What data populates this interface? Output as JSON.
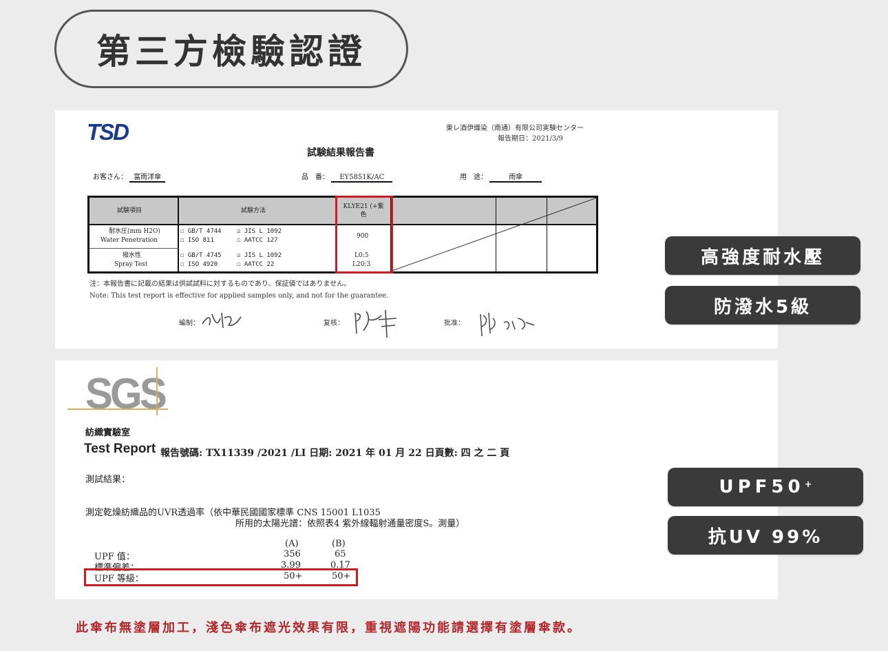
{
  "title": "第三方檢驗認證",
  "tsd_report": {
    "logo": "TSD",
    "lab_name": "東レ酒伊織染（南通）有限公司実験センター",
    "report_date": "報告期日：2021/3/9",
    "heading": "試験結果報告書",
    "customer_label": "お客さん：",
    "customer_value": "富雨洋傘",
    "product_no_label": "品　番：",
    "product_no_value": "EY5851K/AC",
    "usage_label": "用　途：",
    "usage_value": "雨傘",
    "table": {
      "col_item": "試験項目",
      "col_method": "試験方法",
      "col_sample": "KLYE21 (+紫色",
      "row1_item_jp": "耐水圧(mm H2O)",
      "row1_item_en": "Water Penetration",
      "row1_method_a": "☐ GB/T 4744",
      "row1_method_b": "☐ ISO 811",
      "row1_method_c": "☑ JIS L 1092",
      "row1_method_d": "☐ AATCC 127",
      "row1_value": "900",
      "row2_item_jp": "撥水性",
      "row2_item_en": "Spray Test",
      "row2_method_a": "☐ GB/T 4745",
      "row2_method_b": "☐ ISO 4920",
      "row2_method_c": "☑ JIS L 1092",
      "row2_method_d": "☐ AATCC 22",
      "row2_value_a": "L0:5",
      "row2_value_b": "L20:3"
    },
    "note_jp": "注：本報告書に記載の結果は供試試料に対するものであり、保証値ではありません。",
    "note_en": "Note: This test report is effective for applied samples only, and not for the guarantee.",
    "sig1_label": "編制：",
    "sig2_label": "复核：",
    "sig3_label": "批准："
  },
  "sgs_report": {
    "logo": "SGS",
    "lab": "紡織實驗室",
    "test_report": "Test Report",
    "report_no": "報告號碼: TX11339 /2021 /LI 日期: 2021 年 01 月 22 日頁數: 四 之 二 頁",
    "results_label": "測試結果：",
    "uvr_line1": "測定乾燥紡織品的UVR透過率（依中華民國國家標準 CNS 15001 L1035",
    "uvr_line2": "所用的太陽光譜：依照表4 紫外線輻射通量密度S。測量）",
    "col_a": "(A)",
    "col_b": "(B)",
    "row1_label": "UPF 值：",
    "row1_a": "356",
    "row1_b": "65",
    "row2_label": "標準偏差：",
    "row2_a": "3.99",
    "row2_b": "0.17",
    "row3_label": "UPF 等級：",
    "row3_a": "50+",
    "row3_b": "50+"
  },
  "features": {
    "water_pressure": "高強度耐水壓",
    "water_repellent": "防潑水5級",
    "upf": "UPF50",
    "upf_sup": "+",
    "uv": "抗UV 99%"
  },
  "footer_note": "此傘布無塗層加工，淺色傘布遮光效果有限，重視遮陽功能請選擇有塗層傘款。",
  "colors": {
    "background": "#ececec",
    "pill": "#3a3a3a",
    "highlight_red": "#d21a22",
    "footer_red": "#b3262c",
    "tsd_blue": "#1b3a8c"
  }
}
